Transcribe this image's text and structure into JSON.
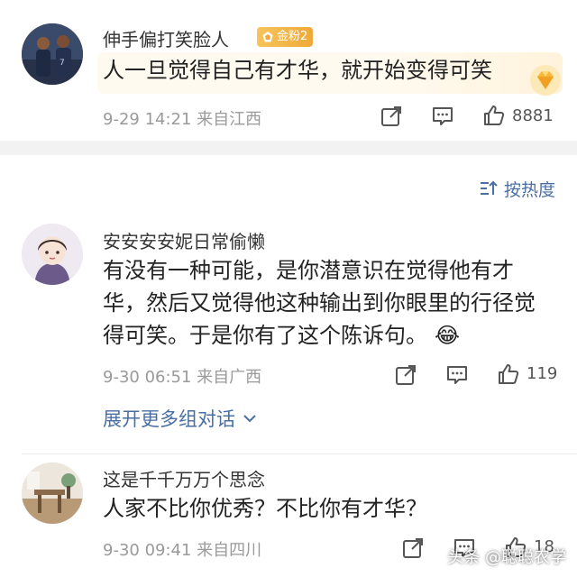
{
  "comments": [
    {
      "user": "伸手偏打笑脸人",
      "badge": "金粉2",
      "text": "人一旦觉得自己有才华，就开始变得可笑",
      "time": "9-29 14:21 来自江西",
      "likes": "8881"
    },
    {
      "user": "安安安安妮日常偷懒",
      "text_lines": [
        "有没有一种可能，是你潜意识在觉得他有才",
        "华，然后又觉得他这种输出到你眼里的行径觉",
        "得可笑。于是你有了这个陈诉句。"
      ],
      "emoji": "😂",
      "time": "9-30 06:51 来自广西",
      "likes": "119"
    },
    {
      "user": "这是千千万万个思念",
      "text": "人家不比你优秀？不比你有才华？",
      "time": "9-30 09:41 来自四川",
      "likes": "18"
    }
  ],
  "sort_label": "按热度",
  "expand_label": "展开更多组对话",
  "watermark": "头条 @聪聪农学",
  "icons": [
    "share-icon",
    "comment-icon",
    "like-icon",
    "sort-icon",
    "chevron-down-icon",
    "gold-fan-badge-icon",
    "gem-icon"
  ],
  "colors": {
    "link": "#4a6fa5",
    "meta": "#9a9a9a",
    "badge": "#f0a93a",
    "divider": "#f2f2f2"
  }
}
